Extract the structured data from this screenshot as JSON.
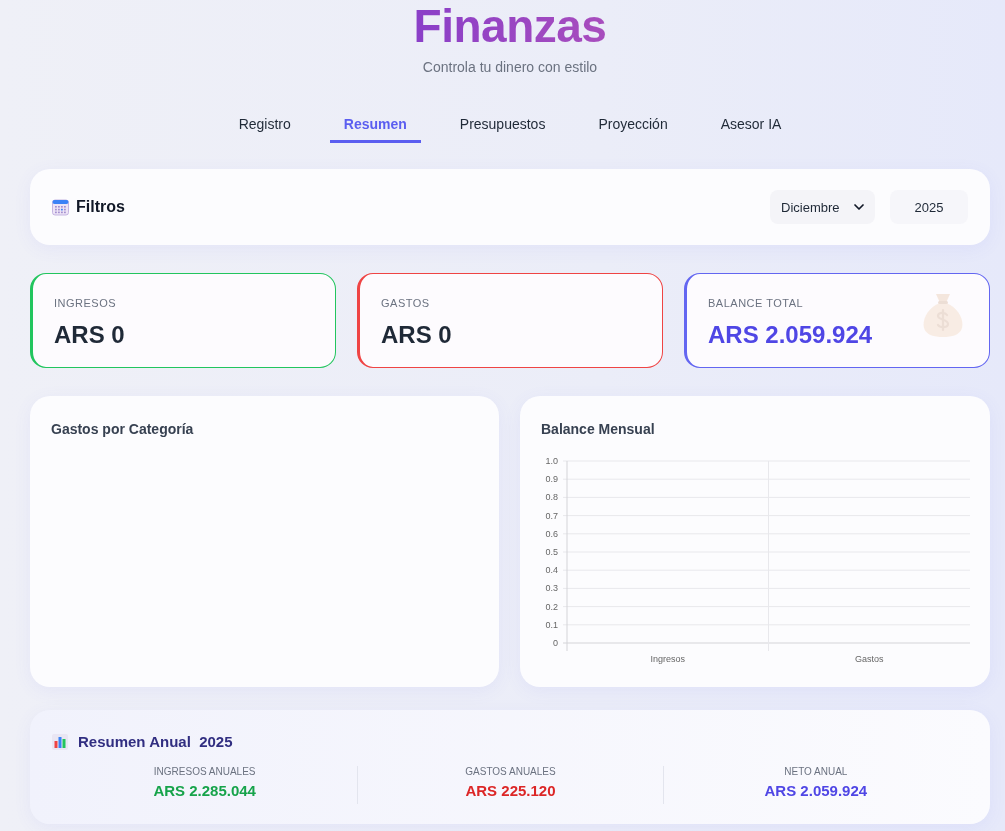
{
  "header": {
    "title": "Finanzas",
    "subtitle": "Controla tu dinero con estilo"
  },
  "tabs": [
    {
      "label": "Registro",
      "selected": false
    },
    {
      "label": "Resumen",
      "selected": true
    },
    {
      "label": "Presupuestos",
      "selected": false
    },
    {
      "label": "Proyección",
      "selected": false
    },
    {
      "label": "Asesor IA",
      "selected": false
    }
  ],
  "filters": {
    "title": "Filtros",
    "month": "Diciembre",
    "year": "2025"
  },
  "cards": [
    {
      "kind": "income",
      "label": "INGRESOS",
      "value": "ARS 0",
      "color": "#22c55e"
    },
    {
      "kind": "expense",
      "label": "GASTOS",
      "value": "ARS 0",
      "color": "#ef4444"
    },
    {
      "kind": "balance",
      "label": "BALANCE TOTAL",
      "value": "ARS 2.059.924",
      "color": "#6366f1"
    }
  ],
  "charts": [
    {
      "title": "Gastos por Categoría"
    },
    {
      "title": "Balance Mensual",
      "chart_data": {
        "type": "bar",
        "categories": [
          "Ingresos",
          "Gastos"
        ],
        "values": [
          0,
          0
        ],
        "ylim": [
          0,
          1
        ],
        "yticks": [
          0,
          0.1,
          0.2,
          0.3,
          0.4,
          0.5,
          0.6,
          0.7,
          0.8,
          0.9,
          {
            "value": 1,
            "label": "1.0"
          }
        ],
        "grid": true
      }
    }
  ],
  "annual": {
    "title": "Resumen Anual  2025",
    "items": [
      {
        "label": "INGRESOS ANUALES",
        "value": "ARS 2.285.044",
        "color": "#16a34a"
      },
      {
        "label": "GASTOS ANUALES",
        "value": "ARS 225.120",
        "color": "#dc2626"
      },
      {
        "label": "NETO ANUAL",
        "value": "ARS 2.059.924",
        "color": "#4f46e5"
      }
    ]
  }
}
